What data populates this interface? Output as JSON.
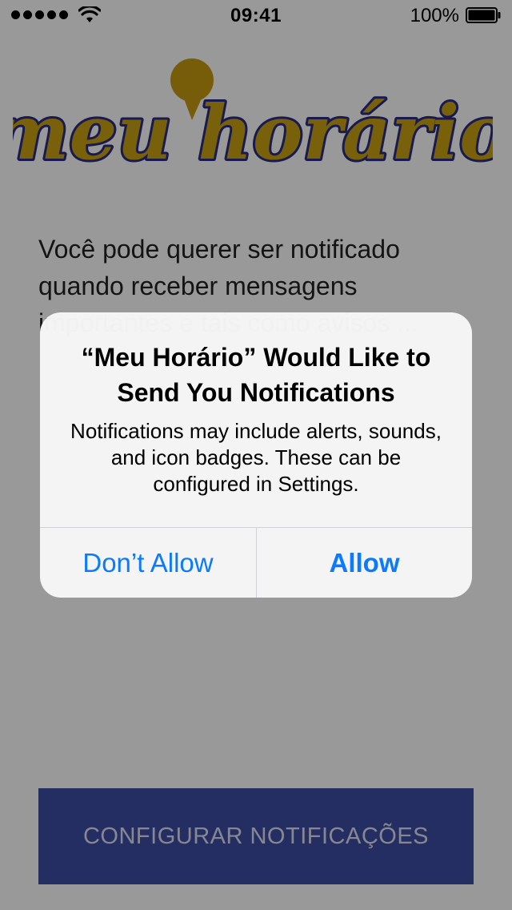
{
  "status_bar": {
    "time": "09:41",
    "battery_percent": "100%",
    "signal_bars": 5
  },
  "logo": {
    "text": "meu horário",
    "colors": {
      "fill": "#caa012",
      "outline": "#2b2e86",
      "pin": "#c69b10"
    }
  },
  "page": {
    "intro": "Você pode querer ser notificado quando receber mensagens importantes e tais como avisos ...",
    "config_button_label": "CONFIGURAR NOTIFICAÇÕES"
  },
  "alert": {
    "title": "“Meu Horário” Would Like to Send You Notifications",
    "message": "Notifications may include alerts, sounds, and icon badges. These can be configured in Settings.",
    "deny_label": "Don’t Allow",
    "allow_label": "Allow"
  },
  "colors": {
    "ios_blue": "#0a7afe",
    "button_bg": "#3e4ea4"
  }
}
